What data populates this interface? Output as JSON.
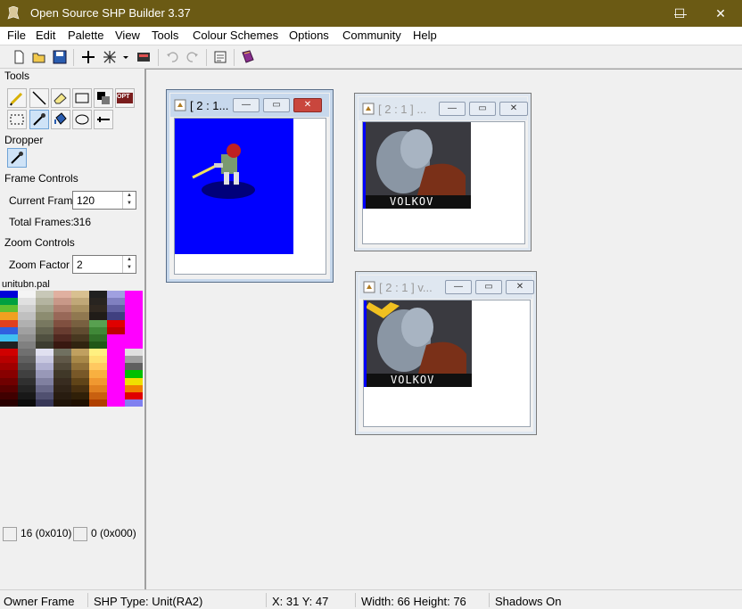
{
  "window": {
    "title": "Open Source SHP Builder 3.37",
    "minimize": "—",
    "maximize": "☐",
    "close": "✕"
  },
  "menu": [
    "File",
    "Edit",
    "Palette",
    "View",
    "Tools",
    "Colour Schemes",
    "Options",
    "Community",
    "Help"
  ],
  "toolbar_icons": [
    "new-file-icon",
    "open-folder-icon",
    "save-icon",
    "crosshair-icon",
    "grid-icon",
    "dropdown-arrow-icon",
    "preview-icon",
    "undo-icon",
    "redo-icon",
    "properties-icon",
    "book-icon"
  ],
  "left_panel": {
    "tools_label": "Tools",
    "tool_icons": [
      "pencil-icon",
      "line-icon",
      "eraser-icon",
      "rectangle-icon",
      "darken-lighten-icon",
      "opt-icon",
      "select-rect-icon",
      "dropper-icon",
      "fill-bucket-icon",
      "ellipse-icon",
      "move-icon"
    ],
    "opt_text": "OPT",
    "dropper_label": "Dropper",
    "frame_controls_label": "Frame Controls",
    "current_frame_label": "Current Frame",
    "current_frame_value": "120",
    "total_frames_label": "Total Frames:",
    "total_frames_value": "316",
    "zoom_controls_label": "Zoom Controls",
    "zoom_factor_label": "Zoom Factor",
    "zoom_factor_value": "2",
    "palette_name": "unitubn.pal",
    "left_swatch_label": "16 (0x010)",
    "right_swatch_label": "0 (0x000)"
  },
  "windows": [
    {
      "title": "[ 2 : 1...",
      "active": true
    },
    {
      "title": "[ 2 : 1 ] ...",
      "active": false
    },
    {
      "title": "[ 2 : 1 ] v...",
      "active": false
    }
  ],
  "mdi_buttons": {
    "min": "—",
    "restore": "▭",
    "close": "✕"
  },
  "sprite_caption": "VOLKOV",
  "status": {
    "owner": "Owner Frame",
    "shp_type": "SHP Type: Unit(RA2)",
    "coords": "X: 31 Y: 47",
    "size": "Width: 66 Height: 76",
    "shadows": "Shadows On"
  },
  "colors": {
    "titlebar": "#6b5a14",
    "canvas_blue": "#0000ff",
    "palette_magenta": "#ff00ff"
  }
}
